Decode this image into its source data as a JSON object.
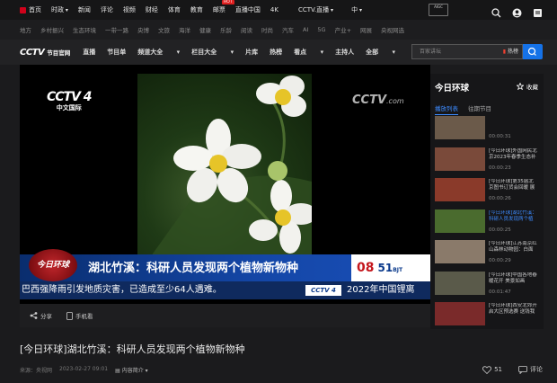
{
  "topnav": {
    "items": [
      "首页",
      "时政",
      "新闻",
      "评论",
      "视频",
      "财经",
      "体育",
      "教育",
      "邮票",
      "直播中国",
      "4K",
      "CCTV.直播",
      "中"
    ],
    "hot_badge": "HOT",
    "aigc": "AIGC"
  },
  "subnav": [
    "地方",
    "乡村振兴",
    "生态环境",
    "一带一路",
    "央博",
    "文旅",
    "海洋",
    "健康",
    "乐龄",
    "阅读",
    "时尚",
    "汽车",
    "AI",
    "5G",
    "产业+",
    "网展",
    "央视网选"
  ],
  "mainnav": {
    "logo": "CCTV",
    "logo_sub": "节目官网",
    "links": [
      "直播",
      "节目单",
      "频道大全",
      "栏目大全",
      "片库",
      "热榜",
      "看点",
      "主持人",
      "全部"
    ],
    "search_placeholder": "百家讲坛",
    "hot_label": "热榜"
  },
  "video": {
    "channel_logo": "CCTV 4",
    "channel_sub": "中文国际",
    "watermark": "CCTV",
    "watermark_sub": ".com",
    "program_badge": "今日环球",
    "headline": "湖北竹溪：科研人员发现两个植物新物种",
    "clock_h": "08",
    "clock_m": "51",
    "clock_tz": "BJT",
    "ticker_left": "巴西强降雨引发地质灾害，已造成至少64人遇难。",
    "ticker_logo": "CCTV 4",
    "ticker_right": "2022年中国锂离"
  },
  "sidebar": {
    "title": "今日环球",
    "fav": "收藏",
    "tab_active": "播放列表",
    "tab_other": "往期节目",
    "items": [
      {
        "text": "",
        "dur": "00:00:31",
        "active": false
      },
      {
        "text": "[今日环球]外国网民北京2023年春季生态补",
        "dur": "00:00:23",
        "active": false
      },
      {
        "text": "[今日环球]第35届北京图书订货会回暖 展",
        "dur": "00:00:26",
        "active": false
      },
      {
        "text": "[今日环球]湖北竹溪：科研人员发现两个植",
        "dur": "00:00:25",
        "active": true
      },
      {
        "text": "[今日环球]江苏南京红山森林动物园：白面",
        "dur": "00:00:29",
        "active": false
      },
      {
        "text": "[今日环球]中国各地春暖花开 美景如画",
        "dur": "00:01:47",
        "active": false
      },
      {
        "text": "[今日环球]西安北郊开启大区预选赛 送钱我",
        "dur": "",
        "active": false
      }
    ]
  },
  "controls": {
    "share": "分享",
    "phone": "手机看"
  },
  "page_title": "[今日环球]湖北竹溪：科研人员发现两个植物新物种",
  "meta": {
    "source": "来源：央视网",
    "date": "2023-02-27 09:01",
    "caption": "内容简介"
  },
  "actions": {
    "likes": "51",
    "comment": "评论"
  }
}
